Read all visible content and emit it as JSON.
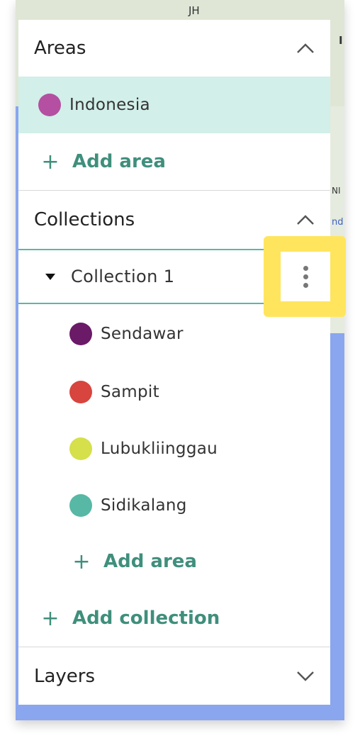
{
  "map": {
    "fragments": [
      "JH",
      "I",
      "NI",
      "nd"
    ]
  },
  "areas": {
    "title": "Areas",
    "items": [
      {
        "label": "Indonesia",
        "color": "#b44fa1",
        "selected": true
      }
    ],
    "add_label": "Add area"
  },
  "collections": {
    "title": "Collections",
    "items": [
      {
        "label": "Collection 1",
        "expanded": true,
        "areas": [
          {
            "label": "Sendawar",
            "color": "#6a1a66"
          },
          {
            "label": "Sampit",
            "color": "#d8443e"
          },
          {
            "label": "Lubukliinggau",
            "color": "#d5e04a"
          },
          {
            "label": "Sidikalang",
            "color": "#57b8a6"
          }
        ],
        "add_label": "Add area"
      }
    ],
    "add_label": "Add collection"
  },
  "layers": {
    "title": "Layers"
  },
  "colors": {
    "accent": "#3f8f7c",
    "selected_bg": "#d2efe9",
    "highlight": "#ffe55e",
    "map_water": "#8aa6ee"
  },
  "icons": {
    "areas_toggle": "chevron-up-icon",
    "collections_toggle": "chevron-up-icon",
    "layers_toggle": "chevron-down-icon",
    "collection_menu": "kebab-menu-icon",
    "collection_expand": "triangle-down-icon",
    "add": "plus-icon"
  }
}
